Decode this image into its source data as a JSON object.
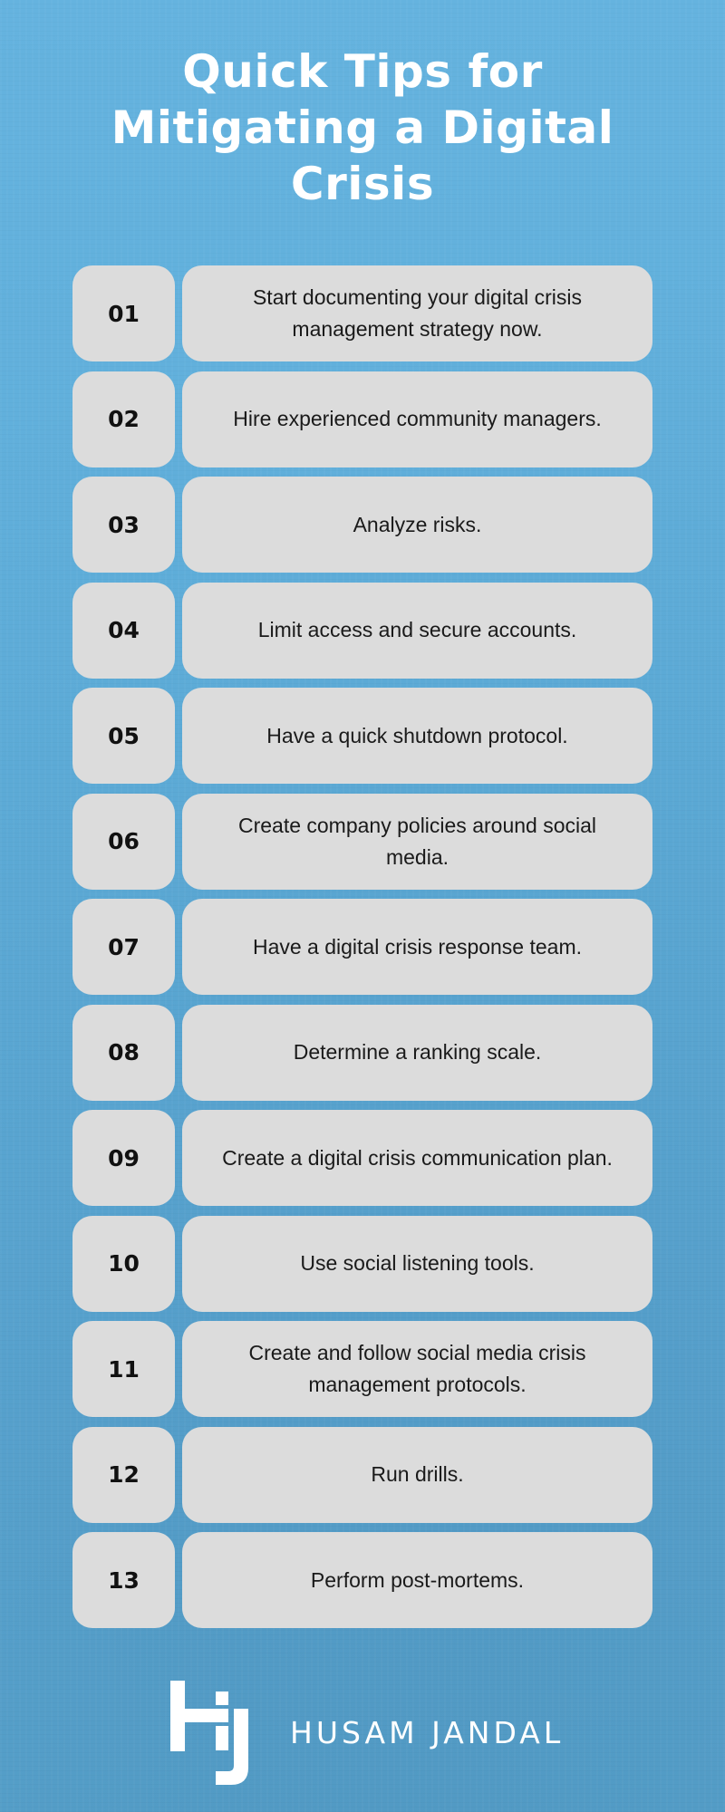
{
  "title": {
    "lines": [
      "Quick Tips for",
      "Mitigating a Digital",
      "Crisis"
    ]
  },
  "tips": [
    {
      "number": "01",
      "text": "Start documenting your digital crisis management strategy now."
    },
    {
      "number": "02",
      "text": "Hire experienced community managers."
    },
    {
      "number": "03",
      "text": "Analyze risks."
    },
    {
      "number": "04",
      "text": "Limit access and secure accounts."
    },
    {
      "number": "05",
      "text": "Have a quick shutdown protocol."
    },
    {
      "number": "06",
      "text": "Create company policies around social media."
    },
    {
      "number": "07",
      "text": "Have a digital crisis response team."
    },
    {
      "number": "08",
      "text": "Determine a ranking scale."
    },
    {
      "number": "09",
      "text": "Create a digital crisis communication plan."
    },
    {
      "number": "10",
      "text": "Use social listening tools."
    },
    {
      "number": "11",
      "text": "Create and follow social media crisis management protocols."
    },
    {
      "number": "12",
      "text": "Run drills."
    },
    {
      "number": "13",
      "text": "Perform post-mortems."
    }
  ],
  "brand": {
    "logo_icon": "hj-monogram-logo",
    "name": "HUSAM JANDAL"
  },
  "colors": {
    "background": "#5eadd9",
    "card": "#dcdcdc",
    "title_text": "#ffffff",
    "card_text": "#1a1a1a"
  }
}
